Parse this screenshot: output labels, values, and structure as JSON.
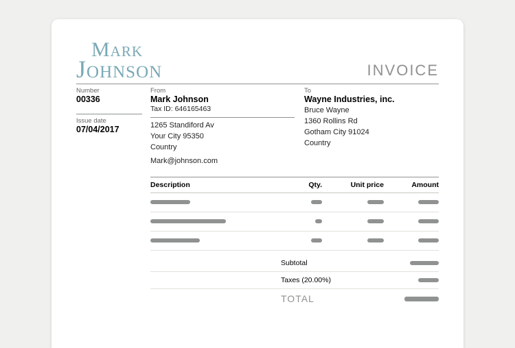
{
  "logo": {
    "line1": "Mark",
    "line2": "Johnson"
  },
  "doc_title": "INVOICE",
  "meta": {
    "number_label": "Number",
    "number": "00336",
    "issue_date_label": "Issue date",
    "issue_date": "07/04/2017"
  },
  "from": {
    "label": "From",
    "name": "Mark Johnson",
    "tax_id": "Tax ID: 646165463",
    "address1": "1265 Standiford Av",
    "address2": "Your City 95350",
    "country": "Country",
    "email": "Mark@johnson.com"
  },
  "to": {
    "label": "To",
    "name": "Wayne Industries, inc.",
    "contact": "Bruce Wayne",
    "address1": "1360 Rollins Rd",
    "address2": "Gotham City 91024",
    "country": "Country"
  },
  "columns": {
    "description": "Description",
    "qty": "Qty.",
    "unit_price": "Unit price",
    "amount": "Amount"
  },
  "totals": {
    "subtotal_label": "Subtotal",
    "taxes_label": "Taxes (20.00%)",
    "total_label": "TOTAL"
  }
}
